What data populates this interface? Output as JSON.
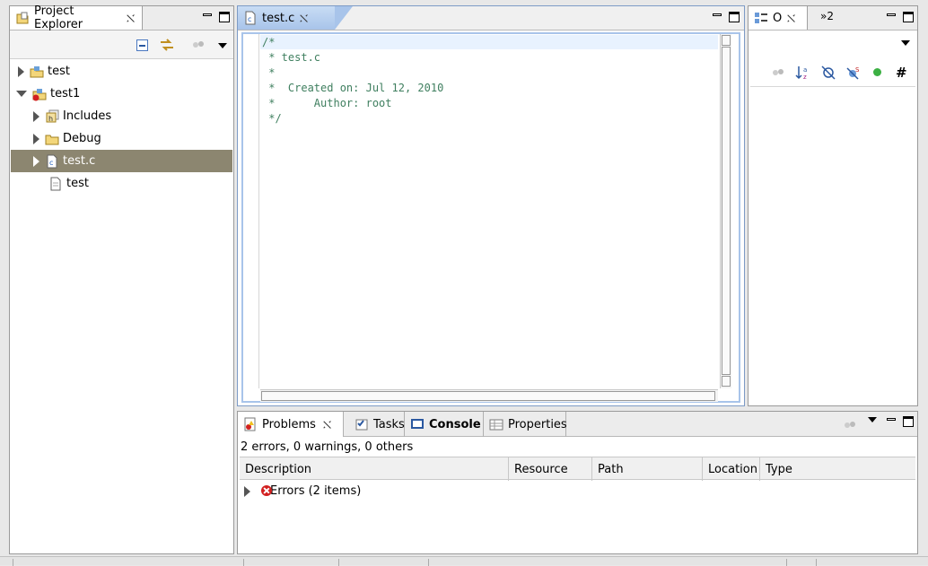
{
  "project_explorer": {
    "tab_label": "Project Explorer",
    "items": [
      {
        "label": "test",
        "level": 0,
        "expander": "collapsed",
        "icon": "project-icon"
      },
      {
        "label": "test1",
        "level": 0,
        "expander": "expanded",
        "icon": "project-error-icon"
      },
      {
        "label": "Includes",
        "level": 1,
        "expander": "collapsed",
        "icon": "includes-icon"
      },
      {
        "label": "Debug",
        "level": 1,
        "expander": "collapsed",
        "icon": "folder-icon"
      },
      {
        "label": "test.c",
        "level": 1,
        "expander": "collapsed",
        "icon": "c-file-icon",
        "selected": true
      },
      {
        "label": "test",
        "level": 1,
        "expander": "none",
        "icon": "file-icon"
      }
    ]
  },
  "editor": {
    "tab_label": "test.c",
    "lines": [
      "/*",
      " * test.c",
      " *",
      " *  Created on: Jul 12, 2010",
      " *      Author: root",
      " */"
    ]
  },
  "outline": {
    "tab_label": "O",
    "overflow_label": "»2"
  },
  "bottom_panel": {
    "tabs": [
      {
        "label": "Problems",
        "active": true
      },
      {
        "label": "Tasks",
        "active": false
      },
      {
        "label": "Console",
        "active": false,
        "bold": true
      },
      {
        "label": "Properties",
        "active": false
      }
    ],
    "summary": "2 errors, 0 warnings, 0 others",
    "columns": [
      "Description",
      "Resource",
      "Path",
      "Location",
      "Type"
    ],
    "rows": [
      {
        "label": "Errors (2 items)"
      }
    ]
  },
  "colors": {
    "selection": "#8c8670",
    "comment": "#3f7f5f",
    "error": "#d22020"
  }
}
